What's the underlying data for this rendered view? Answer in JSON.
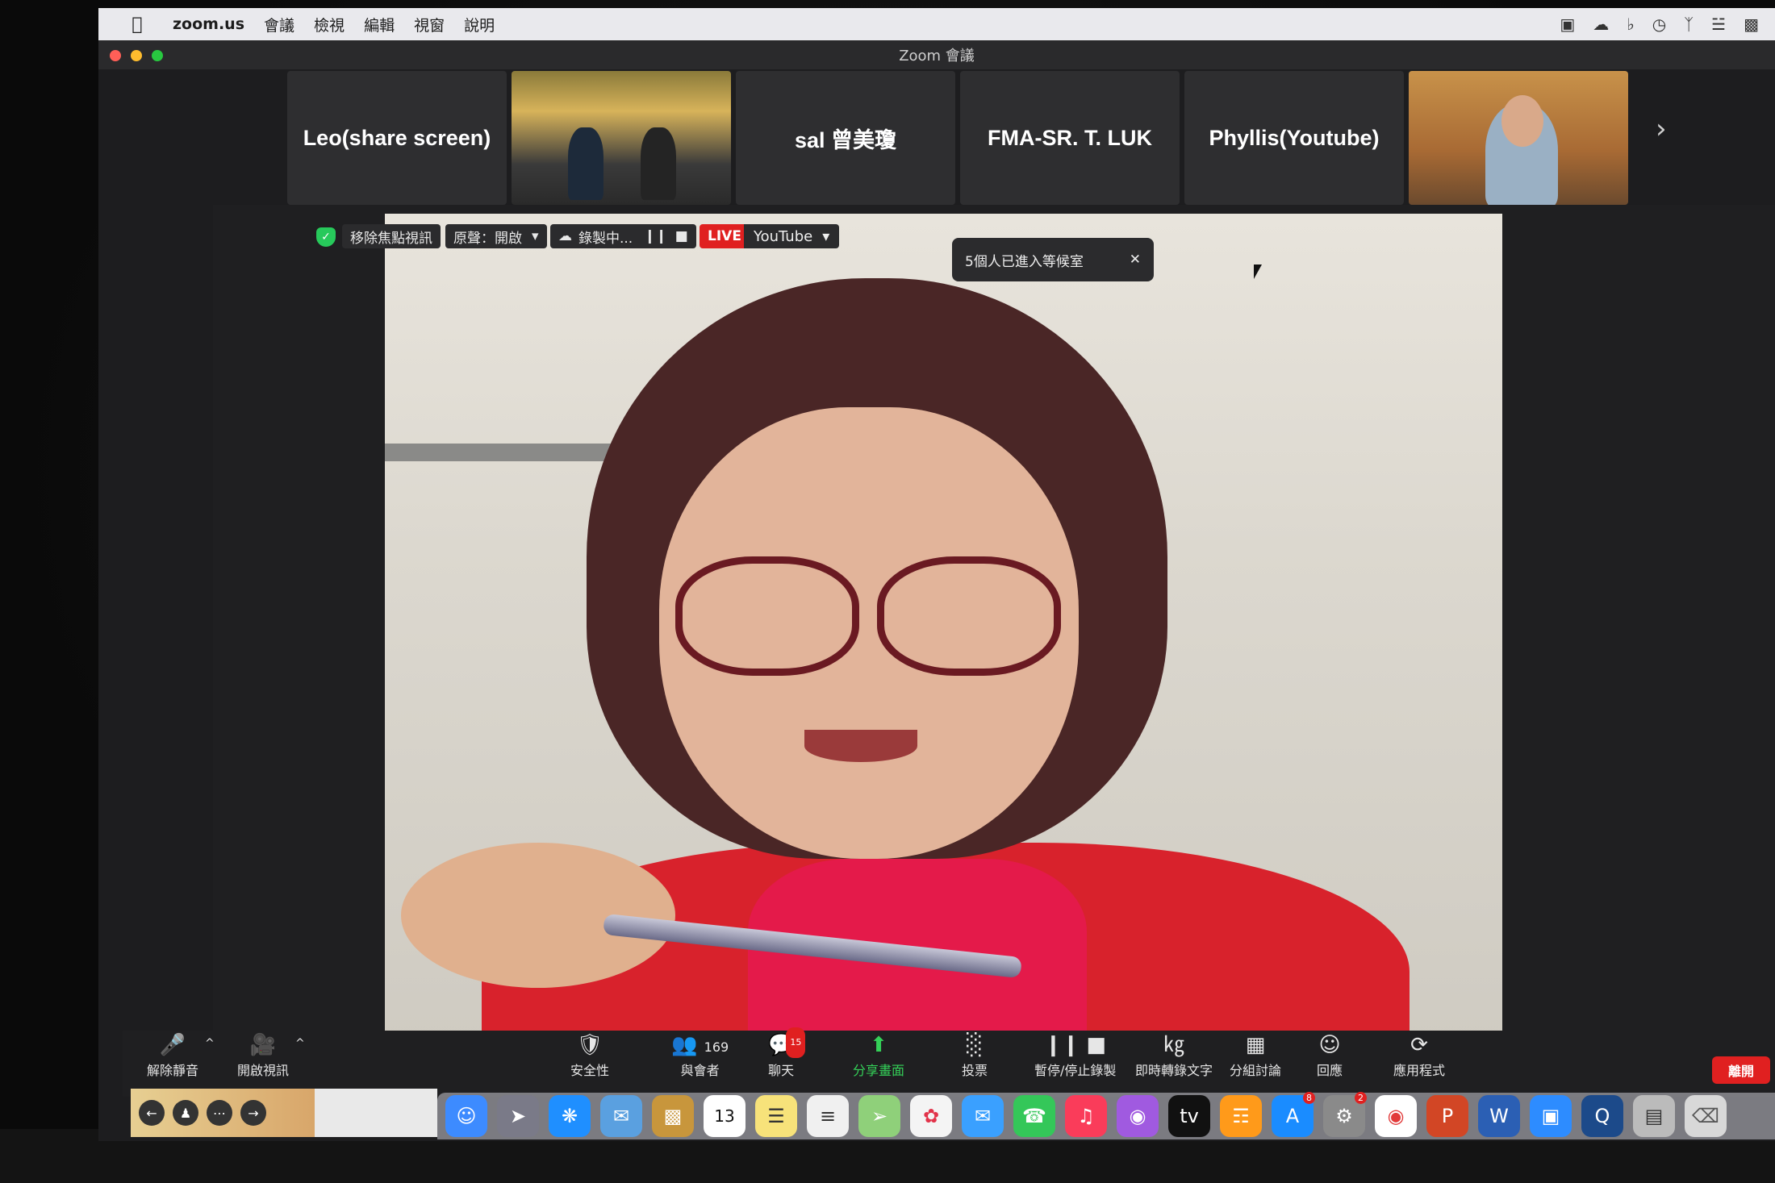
{
  "menubar": {
    "app_name": "zoom.us",
    "items": [
      "會議",
      "檢視",
      "編輯",
      "視窗",
      "說明"
    ]
  },
  "window": {
    "title": "Zoom 會議"
  },
  "thumbnails": [
    {
      "label": "Leo(share screen)",
      "kind": "name"
    },
    {
      "label": "",
      "kind": "photo"
    },
    {
      "label": "sal 曾美瓊",
      "kind": "name"
    },
    {
      "label": "FMA-SR. T. LUK",
      "kind": "name"
    },
    {
      "label": "Phyllis(Youtube)",
      "kind": "name"
    },
    {
      "label": "",
      "kind": "photo"
    }
  ],
  "video_overlay": {
    "remove_focus": "移除焦點視訊",
    "original_audio": "原聲：開啟",
    "recording": "錄製中...",
    "live": "LIVE",
    "stream_target": "YouTube",
    "waiting_room_notice": "5個人已進入等候室"
  },
  "toolbar": {
    "unmute": "解除靜音",
    "start_video": "開啟視訊",
    "security": "安全性",
    "participants": "與會者",
    "participants_count": "169",
    "chat": "聊天",
    "chat_badge": "15",
    "share_screen": "分享畫面",
    "polls": "投票",
    "pause_stop_recording": "暫停/停止錄製",
    "live_transcript": "即時轉錄文字",
    "breakout_rooms": "分組討論",
    "reactions": "回應",
    "apps": "應用程式",
    "leave": "離開"
  },
  "dock": {
    "calendar_day": "13",
    "app_store_badge": "8",
    "settings_badge": "2"
  },
  "colors": {
    "live_red": "#e02020",
    "share_green": "#34d058",
    "toolbar_bg": "#1f1f21"
  }
}
